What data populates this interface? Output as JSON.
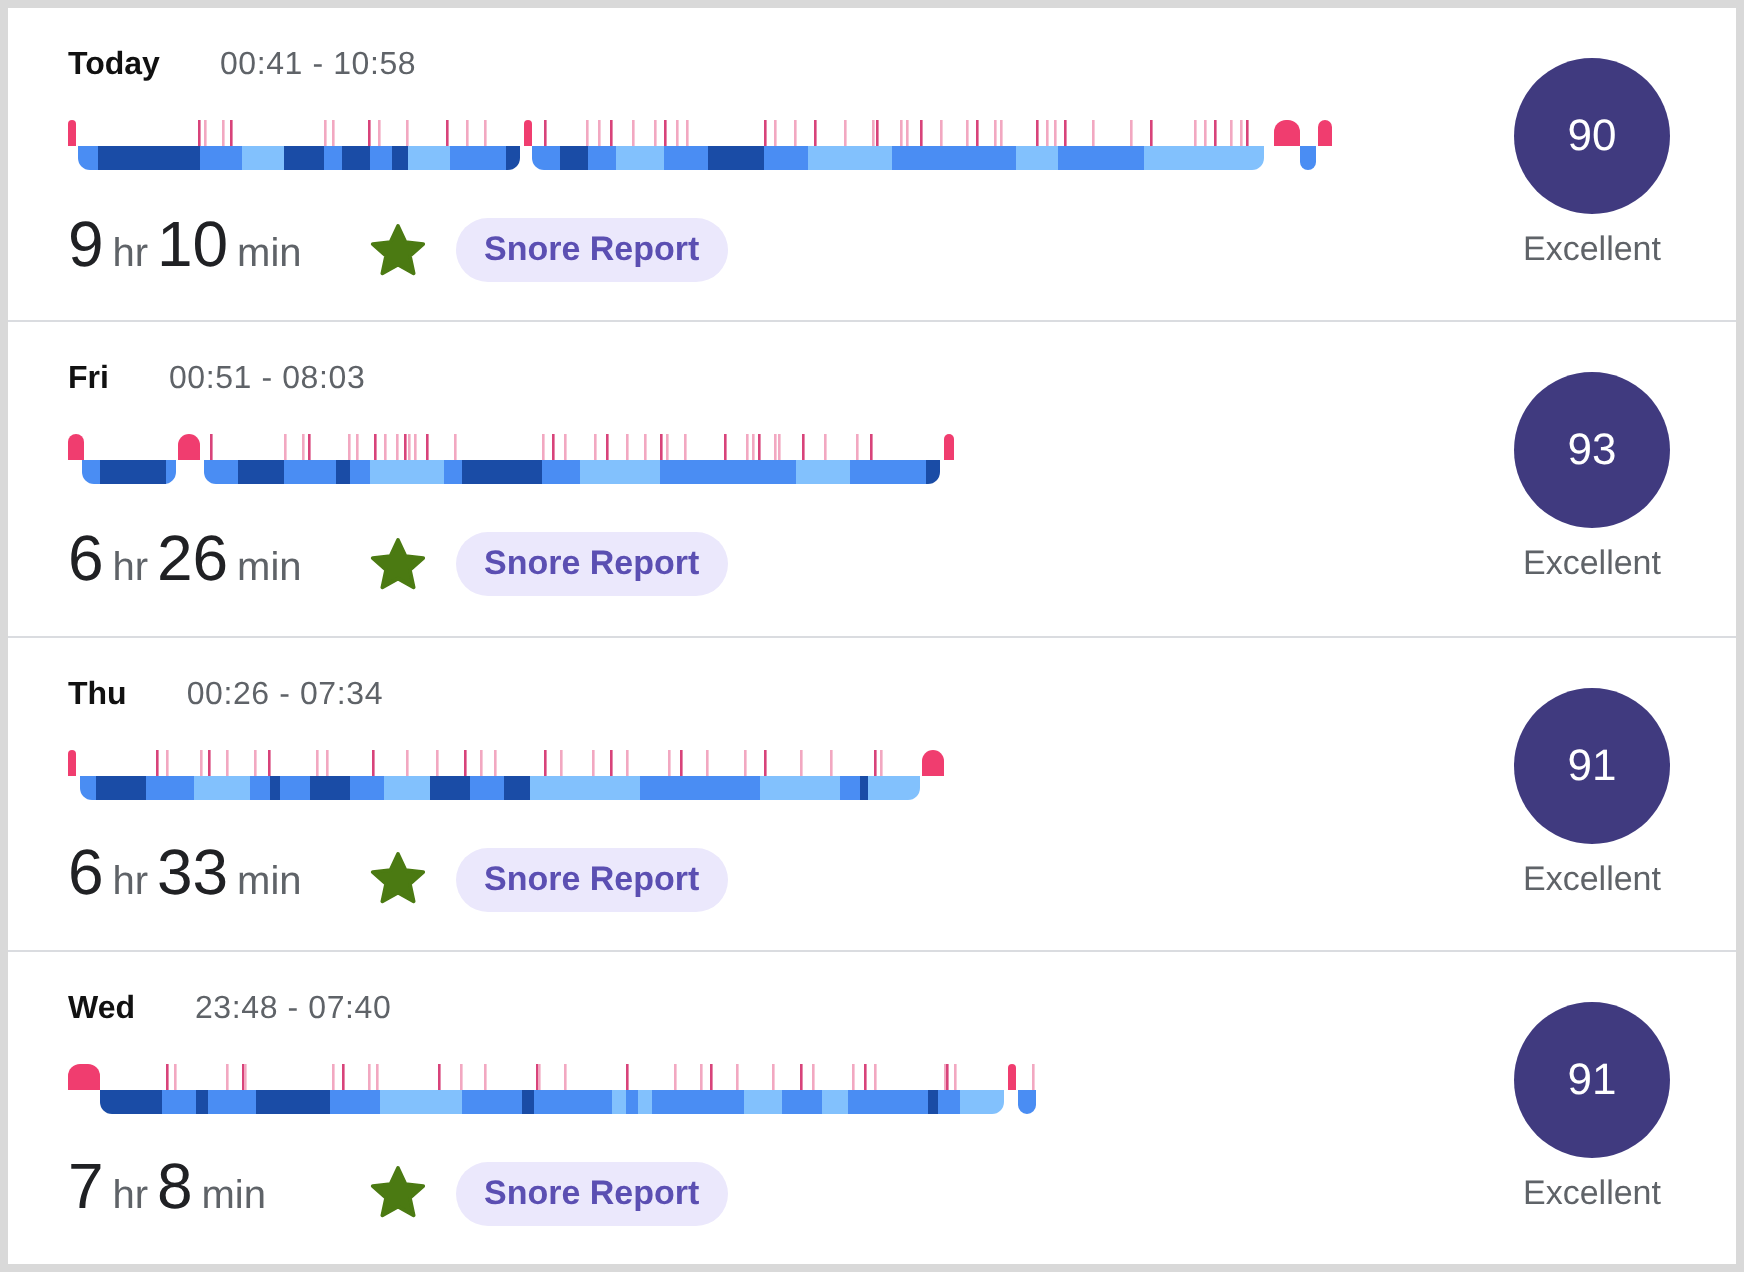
{
  "nights": [
    {
      "day": "Today",
      "time_range": "00:41 - 10:58",
      "duration": {
        "hours": "9",
        "hours_unit": "hr",
        "minutes": "10",
        "minutes_unit": "min"
      },
      "starred": true,
      "snore_button": "Snore Report",
      "score": "90",
      "rating": "Excellent"
    },
    {
      "day": "Fri",
      "time_range": "00:51 - 08:03",
      "duration": {
        "hours": "6",
        "hours_unit": "hr",
        "minutes": "26",
        "minutes_unit": "min"
      },
      "starred": true,
      "snore_button": "Snore Report",
      "score": "93",
      "rating": "Excellent"
    },
    {
      "day": "Thu",
      "time_range": "00:26 - 07:34",
      "duration": {
        "hours": "6",
        "hours_unit": "hr",
        "minutes": "33",
        "minutes_unit": "min"
      },
      "starred": true,
      "snore_button": "Snore Report",
      "score": "91",
      "rating": "Excellent"
    },
    {
      "day": "Wed",
      "time_range": "23:48 - 07:40",
      "duration": {
        "hours": "7",
        "hours_unit": "hr",
        "minutes": "8",
        "minutes_unit": "min"
      },
      "starred": true,
      "snore_button": "Snore Report",
      "score": "91",
      "rating": "Excellent"
    }
  ]
}
